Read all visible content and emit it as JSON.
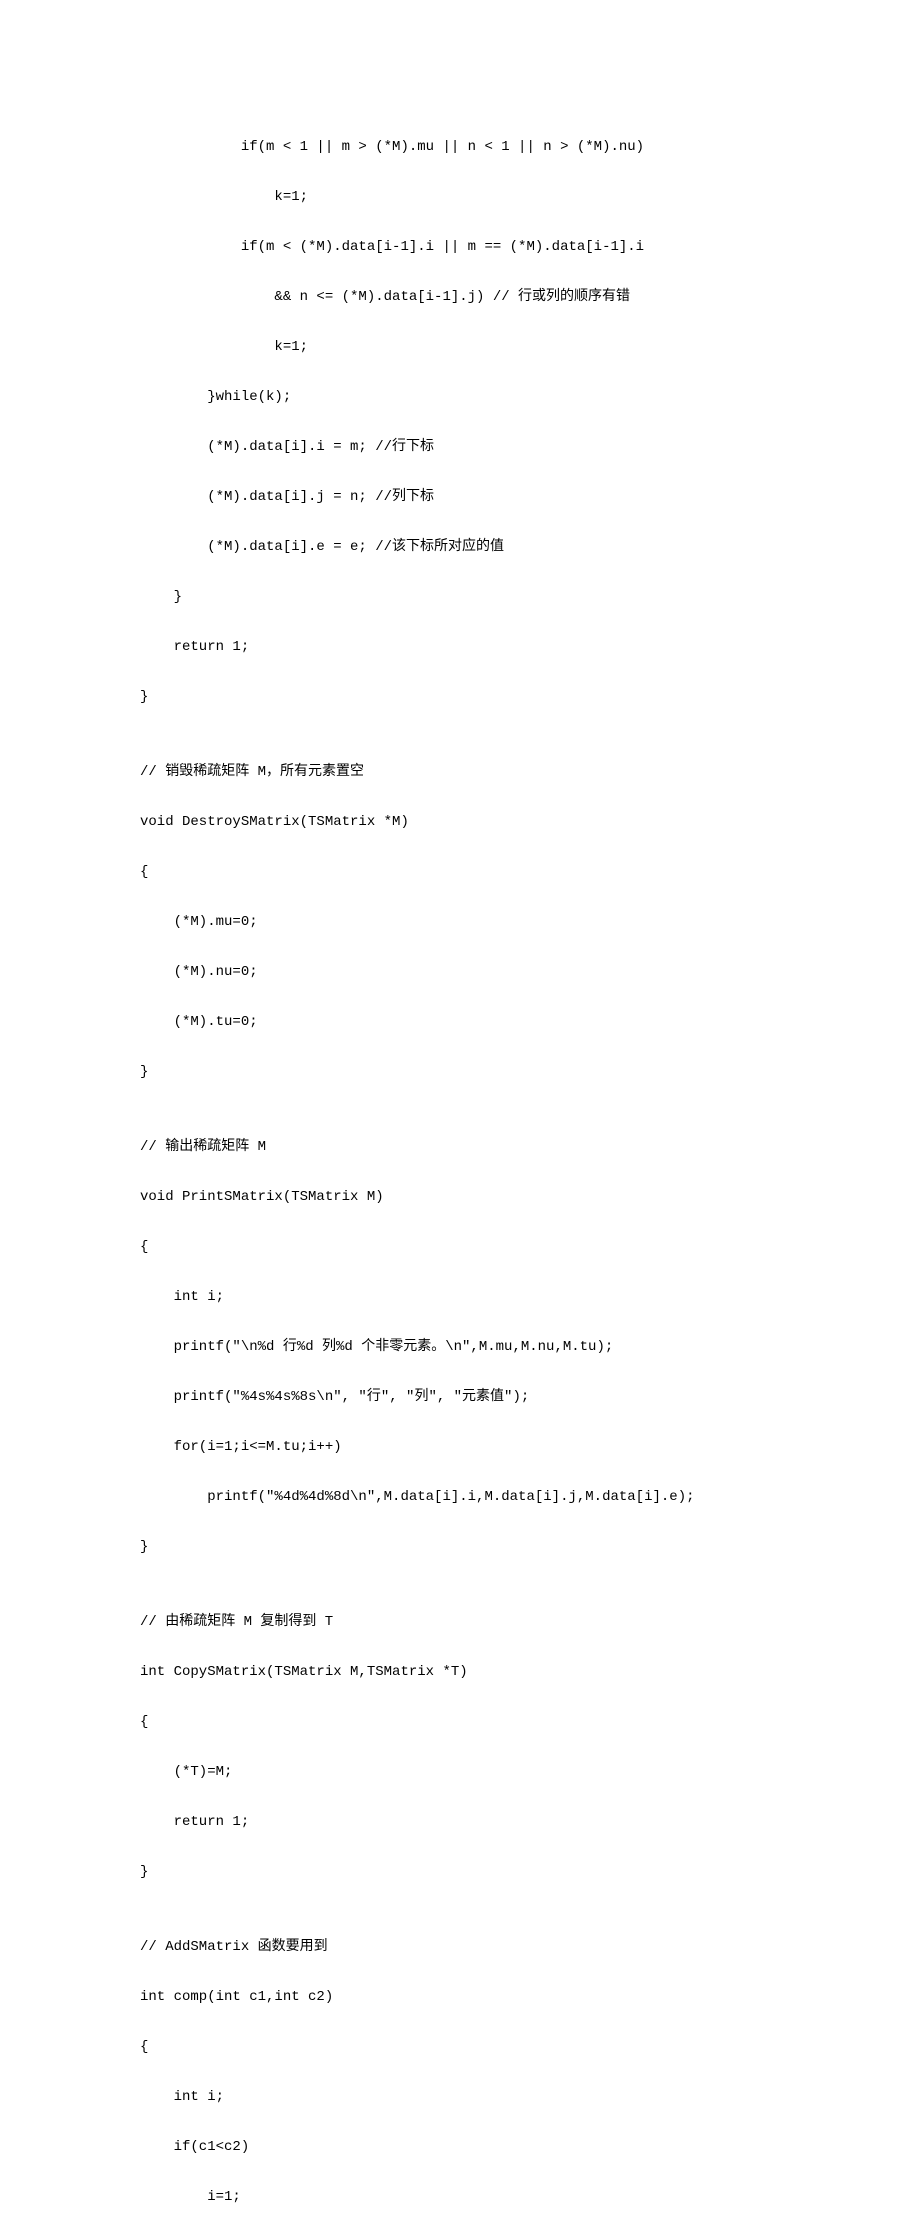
{
  "lines": {
    "l01": "            if(m < 1 || m > (*M).mu || n < 1 || n > (*M).nu)",
    "l02": "                k=1;",
    "l03": "            if(m < (*M).data[i-1].i || m == (*M).data[i-1].i",
    "l04": "                && n <= (*M).data[i-1].j) // 行或列的顺序有错 ",
    "l05": "                k=1;",
    "l06": "        }while(k);",
    "l07": "        (*M).data[i].i = m; //行下标 ",
    "l08": "        (*M).data[i].j = n; //列下标 ",
    "l09": "        (*M).data[i].e = e; //该下标所对应的值 ",
    "l10": "    }",
    "l11": "    return 1;",
    "l12": "}",
    "l13": "",
    "l14": "// 销毁稀疏矩阵 M，所有元素置空",
    "l15": "void DestroySMatrix(TSMatrix *M)",
    "l16": "{",
    "l17": "    (*M).mu=0;",
    "l18": "    (*M).nu=0;",
    "l19": "    (*M).tu=0;",
    "l20": "}",
    "l21": "",
    "l22": "// 输出稀疏矩阵 M",
    "l23": "void PrintSMatrix(TSMatrix M)",
    "l24": "{",
    "l25": "    int i;",
    "l26": "    printf(\"\\n%d 行%d 列%d 个非零元素。\\n\",M.mu,M.nu,M.tu);",
    "l27": "    printf(\"%4s%4s%8s\\n\", \"行\", \"列\", \"元素值\");",
    "l28": "    for(i=1;i<=M.tu;i++)",
    "l29": "        printf(\"%4d%4d%8d\\n\",M.data[i].i,M.data[i].j,M.data[i].e);",
    "l30": "}",
    "l31": "",
    "l32": "// 由稀疏矩阵 M 复制得到 T ",
    "l33": "int CopySMatrix(TSMatrix M,TSMatrix *T)",
    "l34": "{",
    "l35": "    (*T)=M;",
    "l36": "    return 1;",
    "l37": "}",
    "l38": "",
    "l39": "// AddSMatrix 函数要用到 ",
    "l40": "int comp(int c1,int c2)",
    "l41": "{",
    "l42": "    int i;",
    "l43": "    if(c1<c2)",
    "l44": "        i=1;"
  }
}
